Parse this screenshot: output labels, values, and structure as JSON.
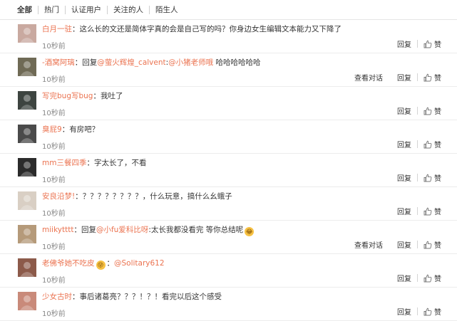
{
  "tabs": [
    "全部",
    "热门",
    "认证用户",
    "关注的人",
    "陌生人"
  ],
  "labels": {
    "reply": "回复",
    "like": "赞",
    "view_conversation": "查看对话",
    "separator": "："
  },
  "comments": [
    {
      "user": "白月一驻",
      "parts": [
        {
          "type": "text",
          "text": "这么长的文还是简体字真的会是自己写的吗？你身边女生编辑文本能力又下降了"
        }
      ],
      "time": "10秒前",
      "view_conversation": false,
      "avatar_color": "#c9a9a0"
    },
    {
      "user": "-酒窝阿璃",
      "parts": [
        {
          "type": "text",
          "text": "回复"
        },
        {
          "type": "mention",
          "text": "@萤火辉煌_calvent"
        },
        {
          "type": "text",
          "text": ":"
        },
        {
          "type": "mention",
          "text": "@小猪老师哦"
        },
        {
          "type": "text",
          "text": " 哈哈哈哈哈哈"
        }
      ],
      "time": "10秒前",
      "view_conversation": true,
      "avatar_color": "#6f6a55"
    },
    {
      "user": "写完bug写bug",
      "parts": [
        {
          "type": "text",
          "text": "我吐了"
        }
      ],
      "time": "10秒前",
      "view_conversation": false,
      "avatar_color": "#3d4440"
    },
    {
      "user": "臭屁9",
      "parts": [
        {
          "type": "text",
          "text": "有房吧？"
        }
      ],
      "time": "10秒前",
      "view_conversation": false,
      "avatar_color": "#4a4a4a"
    },
    {
      "user": "mm三餐四季",
      "parts": [
        {
          "type": "text",
          "text": "字太长了，不看"
        }
      ],
      "time": "10秒前",
      "view_conversation": false,
      "avatar_color": "#2b2b2b"
    },
    {
      "user": "安良沿梦!",
      "parts": [
        {
          "type": "text",
          "text": "？？？？？？？？，什么玩意，搞什么幺蛾子"
        }
      ],
      "time": "10秒前",
      "view_conversation": false,
      "avatar_color": "#d9cfc4"
    },
    {
      "user": "miikytttt",
      "parts": [
        {
          "type": "text",
          "text": "回复"
        },
        {
          "type": "mention",
          "text": "@小fu爱科比呀"
        },
        {
          "type": "text",
          "text": ":太长我都没看完 等你总结呢"
        },
        {
          "type": "emoji",
          "text": "😂"
        }
      ],
      "time": "10秒前",
      "view_conversation": true,
      "avatar_color": "#b59a7a"
    },
    {
      "user": "老佛爷她不吃皮",
      "parts": [
        {
          "type": "emoji",
          "text": "😜"
        },
        {
          "type": "text",
          "text": "："
        },
        {
          "type": "mention",
          "text": "@Solitary612"
        }
      ],
      "time": "10秒前",
      "view_conversation": false,
      "avatar_color": "#8c5a4a",
      "no_separator": true
    },
    {
      "user": "少女古时",
      "parts": [
        {
          "type": "text",
          "text": "事后诸葛亮？？？！？！看完以后这个感受"
        }
      ],
      "time": "10秒前",
      "view_conversation": false,
      "avatar_color": "#c98a7a"
    }
  ]
}
